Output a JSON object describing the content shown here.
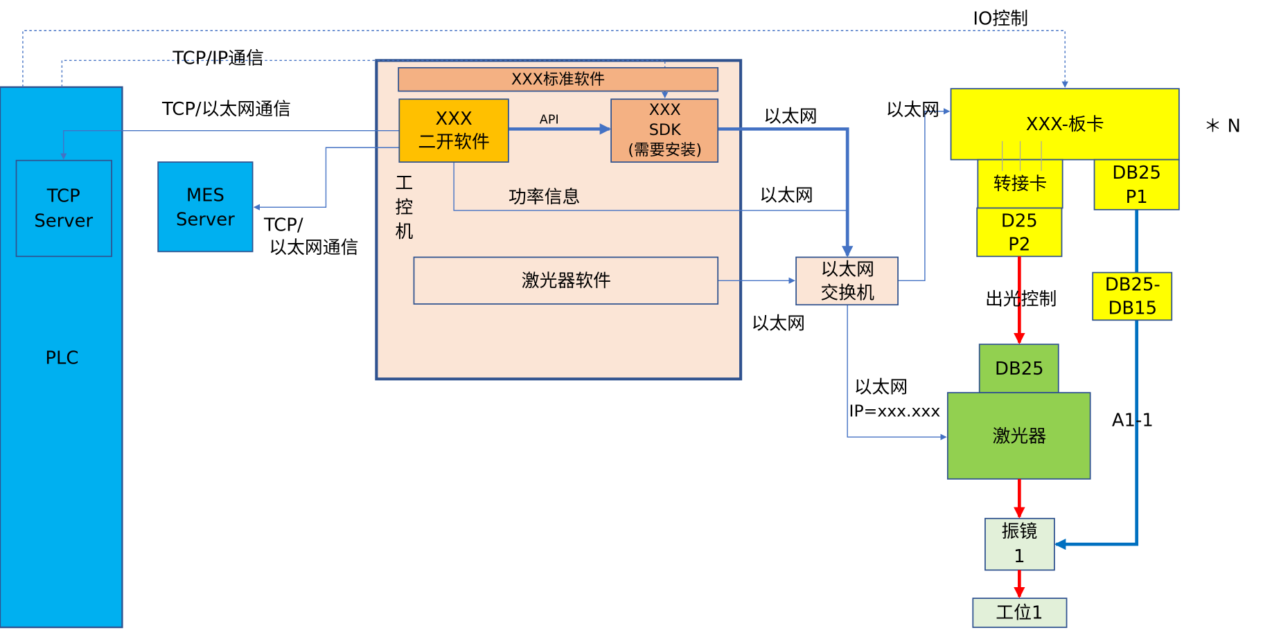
{
  "colors": {
    "plc": "#00B0F0",
    "ipc_bg": "#FBE5D6",
    "ipc_border": "#2F528F",
    "software": "#F4B183",
    "custom_software": "#FFC000",
    "card": "#FFFF00",
    "laser": "#92D050",
    "galvo": "#E2F0D9",
    "link": "#4472C4",
    "laser_control": "#FF0000",
    "galvo_signal": "#0070C0"
  },
  "nodes": {
    "plc": "PLC",
    "tcp_server": [
      "TCP",
      "Server"
    ],
    "mes_server": [
      "MES",
      "Server"
    ],
    "ipc": [
      "工",
      "控",
      "机"
    ],
    "standard_software": "XXX标准软件",
    "custom_software": [
      "XXX",
      "二开软件"
    ],
    "sdk": [
      "XXX",
      "SDK",
      "(需要安装)"
    ],
    "laser_software": "激光器软件",
    "switch": [
      "以太网",
      "交换机"
    ],
    "board": "XXX-板卡",
    "multiplier": "＊ N",
    "adapter_card": "转接卡",
    "d25_p2": [
      "D25",
      "P2"
    ],
    "db25_p1": [
      "DB25",
      "P1"
    ],
    "db25_db15": [
      "DB25-",
      "DB15"
    ],
    "db25": "DB25",
    "laser": "激光器",
    "galvo": [
      "振镜",
      "1"
    ],
    "station": "工位1"
  },
  "labels": {
    "io_control": "IO控制",
    "tcp_ip": "TCP/IP通信",
    "tcp_ethernet": "TCP/以太网通信",
    "mes_link": [
      "TCP/",
      "以太网通信"
    ],
    "api": "API",
    "power_info": "功率信息",
    "eth_sdk": "以太网",
    "eth_board": "以太网",
    "eth_power": "以太网",
    "eth_laser_sw": "以太网",
    "eth_laser": [
      "以太网",
      "IP=xxx.xxx"
    ],
    "light_control": "出光控制",
    "a1_1": "A1-1"
  }
}
